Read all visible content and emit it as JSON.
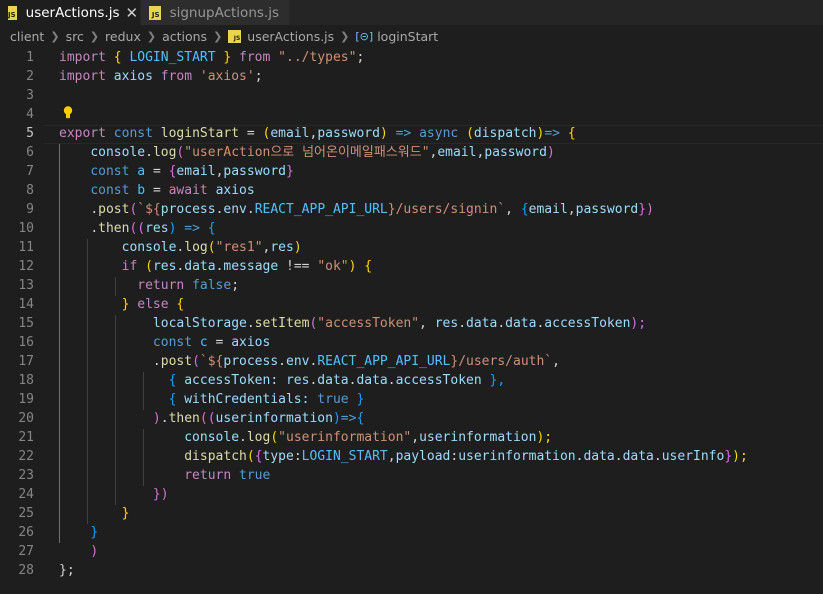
{
  "tabs": [
    {
      "label": "userActions.js",
      "icon": "js-file-icon",
      "active": true
    },
    {
      "label": "signupActions.js",
      "icon": "js-file-icon",
      "active": false
    }
  ],
  "breadcrumb": [
    "client",
    "src",
    "redux",
    "actions",
    "userActions.js",
    "loginStart"
  ],
  "line_numbers": [
    "1",
    "2",
    "3",
    "4",
    "5",
    "6",
    "7",
    "8",
    "9",
    "10",
    "11",
    "12",
    "13",
    "14",
    "15",
    "16",
    "17",
    "18",
    "19",
    "20",
    "21",
    "22",
    "23",
    "24",
    "25",
    "26",
    "27",
    "28"
  ],
  "current_line": "5",
  "code": {
    "l1": [
      "import",
      "{",
      "LOGIN_START",
      "}",
      "from",
      "\"../types\"",
      ";"
    ],
    "l2": [
      "import",
      "axios",
      "from",
      "'axios'",
      ";"
    ],
    "l5": [
      "export",
      "const",
      "loginStart",
      "=",
      "(",
      "email",
      ",",
      "password",
      ")",
      "=>",
      "async",
      "(",
      "dispatch",
      ")",
      "=>",
      "{"
    ],
    "l6": [
      "console",
      ".",
      "log",
      "(",
      "\"userAction으로 넘어온이메일패스워드\"",
      ",",
      "email",
      ",",
      "password",
      ")"
    ],
    "l7": [
      "const",
      "a",
      "=",
      "{",
      "email",
      ",",
      "password",
      "}"
    ],
    "l8": [
      "const",
      "b",
      "=",
      "await",
      "axios"
    ],
    "l9": [
      ".",
      "post",
      "(",
      "`${",
      "process",
      ".",
      "env",
      ".",
      "REACT_APP_API_URL",
      "}",
      "/users/signin`",
      ",",
      "{",
      "email",
      ",",
      "password",
      "})"
    ],
    "l10": [
      ".",
      "then",
      "((",
      "res",
      ")",
      "=>",
      "{"
    ],
    "l11": [
      "console",
      ".",
      "log",
      "(",
      "\"res1\"",
      ",",
      "res",
      ")"
    ],
    "l12": [
      "if",
      "(",
      "res",
      ".",
      "data",
      ".",
      "message",
      "!==",
      "\"ok\"",
      ")",
      "{"
    ],
    "l13": [
      "return",
      "false",
      ";"
    ],
    "l14": [
      "}",
      "else",
      "{"
    ],
    "l15": [
      "localStorage",
      ".",
      "setItem",
      "(",
      "\"accessToken\"",
      ",",
      "res",
      ".",
      "data",
      ".",
      "data",
      ".",
      "accessToken",
      ");"
    ],
    "l16": [
      "const",
      "c",
      "=",
      "axios"
    ],
    "l17": [
      ".",
      "post",
      "(",
      "`${",
      "process",
      ".",
      "env",
      ".",
      "REACT_APP_API_URL",
      "}",
      "/users/auth`",
      ","
    ],
    "l18": [
      "{",
      "accessToken",
      ":",
      "res",
      ".",
      "data",
      ".",
      "data",
      ".",
      "accessToken",
      "},"
    ],
    "l19": [
      "{",
      "withCredentials",
      ":",
      "true",
      "}"
    ],
    "l20": [
      ")",
      ".",
      "then",
      "((",
      "userinformation",
      ")",
      "=>",
      "{"
    ],
    "l21": [
      "console",
      ".",
      "log",
      "(",
      "\"userinformation\"",
      ",",
      "userinformation",
      ");"
    ],
    "l22": [
      "dispatch",
      "(",
      "{",
      "type",
      ":",
      "LOGIN_START",
      ",",
      "payload",
      ":",
      "userinformation",
      ".",
      "data",
      ".",
      "data",
      ".",
      "userInfo",
      "}",
      ");"
    ],
    "l23": [
      "return",
      "true"
    ],
    "l24": [
      "})"
    ],
    "l25": [
      "}"
    ],
    "l26": [
      "}"
    ],
    "l27": [
      ")"
    ],
    "l28": [
      "};"
    ]
  },
  "colors": {
    "background": "#1e1e1e",
    "keyword": "#569cd6",
    "control_keyword": "#c586c0",
    "string": "#ce9178",
    "function": "#dcdcaa",
    "variable": "#9cdcfe",
    "constant": "#4fc1ff",
    "bracket_1": "#ffd700",
    "bracket_2": "#da70d6",
    "bracket_3": "#179fff",
    "line_number": "#858585"
  }
}
